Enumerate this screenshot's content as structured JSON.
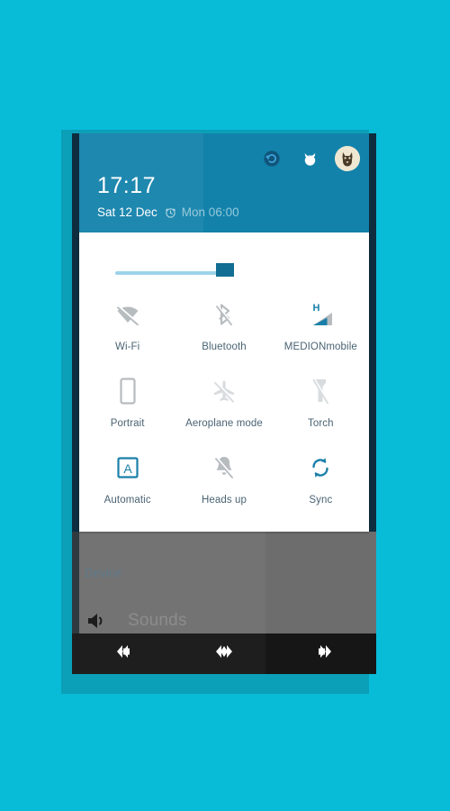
{
  "theme": {
    "page_background": "#08bcd8",
    "frame_background": "#0b9fb8",
    "shade_header_blue": "#1282ab",
    "shade_edge_navy": "#0e2d3f",
    "card_white": "#ffffff",
    "tile_label_blue_grey": "#4a6373",
    "tile_active_blue": "#1a7fa8",
    "tile_inactive_grey": "#b7bcbf",
    "tile_disabled_grey": "#d8dcde",
    "navbar_black": "#161616",
    "settings_dim_grey": "#6d6d6d"
  },
  "status_shade": {
    "header": {
      "clock_time": "17:17",
      "date": "Sat 12 Dec",
      "alarm_icon": "alarm-clock-icon",
      "alarm_time": "Mon 06:00",
      "icons": [
        {
          "name": "sync-status-icon",
          "glyph": "⟳"
        },
        {
          "name": "firefox-icon",
          "glyph": "ƅ"
        },
        {
          "name": "user-avatar",
          "glyph": "🐕"
        }
      ]
    },
    "brightness": {
      "name": "brightness-slider",
      "value_percent": 68
    },
    "tiles": [
      {
        "label": "Wi-Fi",
        "icon": "wifi-off-icon",
        "state": "off"
      },
      {
        "label": "Bluetooth",
        "icon": "bluetooth-off-icon",
        "state": "off"
      },
      {
        "label": "MEDIONmobile",
        "icon": "mobile-signal-icon",
        "state": "on",
        "network_type": "H"
      },
      {
        "label": "Portrait",
        "icon": "screen-rotation-lock-icon",
        "state": "off"
      },
      {
        "label": "Aeroplane mode",
        "icon": "airplane-off-icon",
        "state": "disabled"
      },
      {
        "label": "Torch",
        "icon": "flashlight-off-icon",
        "state": "disabled"
      },
      {
        "label": "Automatic",
        "icon": "auto-brightness-icon",
        "state": "on"
      },
      {
        "label": "Heads up",
        "icon": "notification-off-icon",
        "state": "off"
      },
      {
        "label": "Sync",
        "icon": "sync-icon",
        "state": "on"
      }
    ]
  },
  "settings_behind": {
    "section_label": "Device",
    "rows": [
      {
        "label": "Sounds",
        "icon": "speaker-icon"
      }
    ]
  },
  "nav_bar": {
    "buttons": [
      {
        "name": "nav-back-button",
        "icon": "back-chevron-icon"
      },
      {
        "name": "nav-home-button",
        "icon": "home-diamond-icon"
      },
      {
        "name": "nav-recents-button",
        "icon": "recents-chevron-icon"
      }
    ]
  }
}
